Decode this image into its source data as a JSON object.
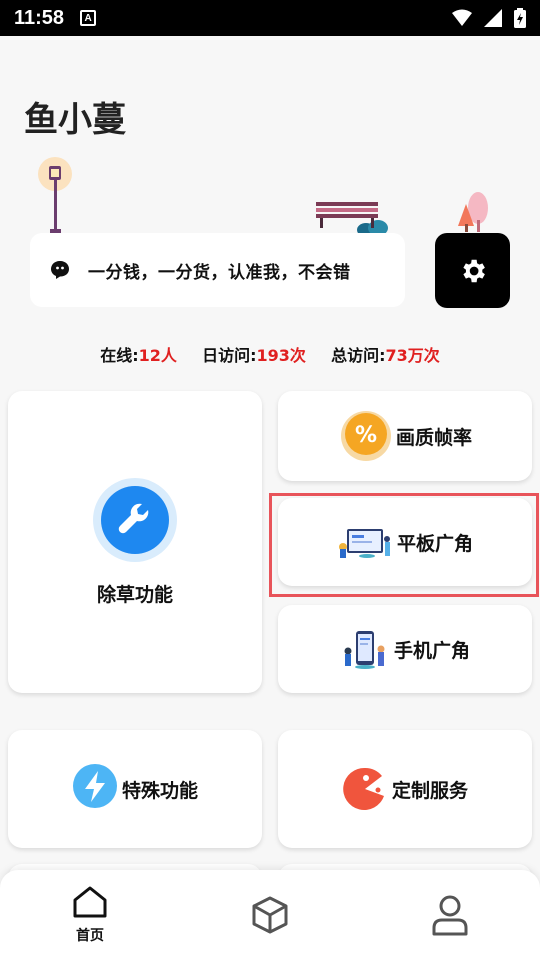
{
  "status_bar": {
    "time": "11:58",
    "badge": "A"
  },
  "app": {
    "title": "鱼小蔓"
  },
  "notice": {
    "text": "一分钱，一分货，认准我，不会错",
    "icon": "chat-bubble-icon"
  },
  "settings": {
    "icon": "gear-icon"
  },
  "stats": {
    "online_label": "在线:",
    "online_value": "12人",
    "daily_label": "日访问:",
    "daily_value": "193次",
    "total_label": "总访问:",
    "total_value": "73万次"
  },
  "features": {
    "weeding": {
      "label": "除草功能",
      "icon": "wrench-icon"
    },
    "quality": {
      "label": "画质帧率",
      "icon": "percent-icon"
    },
    "tablet": {
      "label": "平板广角",
      "icon": "tablet-illustration-icon"
    },
    "phone": {
      "label": "手机广角",
      "icon": "phone-illustration-icon"
    },
    "special": {
      "label": "特殊功能",
      "icon": "lightning-icon"
    },
    "custom": {
      "label": "定制服务",
      "icon": "pacman-icon"
    }
  },
  "nav": {
    "home": {
      "label": "首页",
      "icon": "home-icon"
    },
    "cube": {
      "icon": "cube-icon"
    },
    "profile": {
      "icon": "user-icon"
    }
  },
  "colors": {
    "accent_red": "#e02020",
    "highlight_border": "#e8545a",
    "wrench_blue": "#1e88f0",
    "percent_orange": "#f5a623",
    "pacman_red": "#f0553d",
    "lightning_blue": "#4db5f5"
  }
}
